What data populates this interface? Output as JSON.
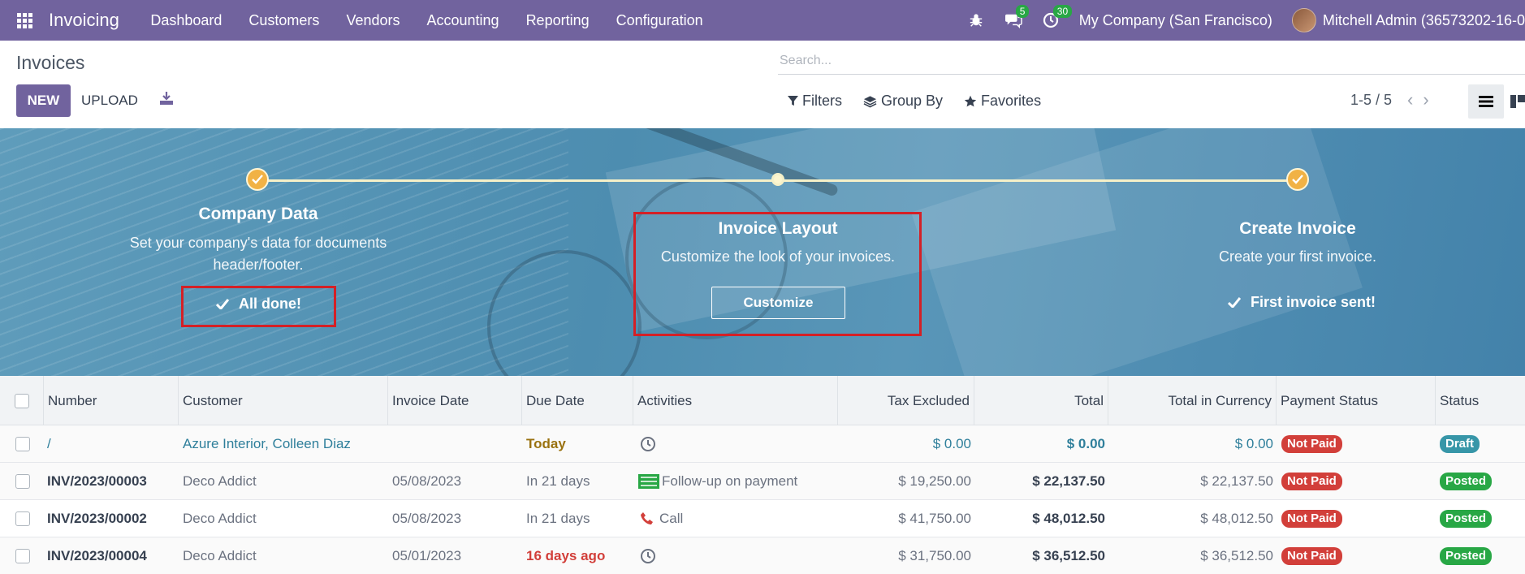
{
  "navbar": {
    "brand": "Invoicing",
    "menu": [
      "Dashboard",
      "Customers",
      "Vendors",
      "Accounting",
      "Reporting",
      "Configuration"
    ],
    "messages_count": "5",
    "activities_count": "30",
    "company": "My Company (San Francisco)",
    "user": "Mitchell Admin (36573202-16-0"
  },
  "control": {
    "title": "Invoices",
    "new_label": "NEW",
    "upload_label": "UPLOAD",
    "search_placeholder": "Search...",
    "filters_label": "Filters",
    "groupby_label": "Group By",
    "favorites_label": "Favorites",
    "pager": "1-5 / 5"
  },
  "banner": {
    "steps": [
      {
        "title": "Company Data",
        "desc_line1": "Set your company's data for documents",
        "desc_line2": "header/footer.",
        "done_label": "All done!"
      },
      {
        "title": "Invoice Layout",
        "desc": "Customize the look of your invoices.",
        "button": "Customize"
      },
      {
        "title": "Create Invoice",
        "desc": "Create your first invoice.",
        "done_label": "First invoice sent!"
      }
    ],
    "colors": {
      "step_done": "#f1b245",
      "highlight": "#d42026"
    }
  },
  "table": {
    "headers": [
      "Number",
      "Customer",
      "Invoice Date",
      "Due Date",
      "Activities",
      "Tax Excluded",
      "Total",
      "Total in Currency",
      "Payment Status",
      "Status"
    ],
    "rows": [
      {
        "number": "/",
        "customer": "Azure Interior, Colleen Diaz",
        "invoice_date": "",
        "due_date": "Today",
        "activity": "",
        "activity_icon": "clock-icon",
        "tax_excluded": "$ 0.00",
        "total": "$ 0.00",
        "total_currency": "$ 0.00",
        "payment_status": "Not Paid",
        "status": "Draft"
      },
      {
        "number": "INV/2023/00003",
        "customer": "Deco Addict",
        "invoice_date": "05/08/2023",
        "due_date": "In 21 days",
        "activity": "Follow-up on payment",
        "activity_icon": "followup-icon",
        "tax_excluded": "$ 19,250.00",
        "total": "$ 22,137.50",
        "total_currency": "$ 22,137.50",
        "payment_status": "Not Paid",
        "status": "Posted"
      },
      {
        "number": "INV/2023/00002",
        "customer": "Deco Addict",
        "invoice_date": "05/08/2023",
        "due_date": "In 21 days",
        "activity": "Call",
        "activity_icon": "phone-icon",
        "tax_excluded": "$ 41,750.00",
        "total": "$ 48,012.50",
        "total_currency": "$ 48,012.50",
        "payment_status": "Not Paid",
        "status": "Posted"
      },
      {
        "number": "INV/2023/00004",
        "customer": "Deco Addict",
        "invoice_date": "05/01/2023",
        "due_date": "16 days ago",
        "activity": "",
        "activity_icon": "clock-icon",
        "tax_excluded": "$ 31,750.00",
        "total": "$ 36,512.50",
        "total_currency": "$ 36,512.50",
        "payment_status": "Not Paid",
        "status": "Posted"
      }
    ]
  }
}
